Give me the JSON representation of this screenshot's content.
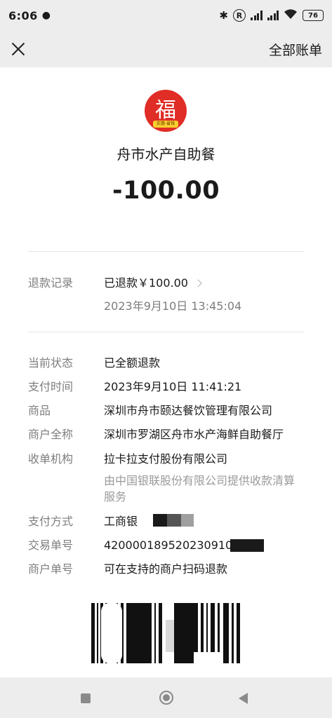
{
  "status_bar": {
    "time": "6:06",
    "left_icon": "notification-icon",
    "right_icons": [
      "bluetooth-icon",
      "registered-icon",
      "signal-icon",
      "signal-icon",
      "wifi-icon",
      "battery-icon"
    ],
    "registered_symbol": "R",
    "battery_level": "76"
  },
  "nav": {
    "close_icon": "close-icon",
    "all_bills_label": "全部账单"
  },
  "merchant": {
    "logo_glyph": "福",
    "logo_tag": "实惠·省钱",
    "name": "舟市水产自助餐",
    "amount": "-100.00"
  },
  "refund": {
    "label": "退款记录",
    "status": "已退款￥100.00",
    "time": "2023年9月10日 13:45:04"
  },
  "details": {
    "status_label": "当前状态",
    "status_value": "已全额退款",
    "pay_time_label": "支付时间",
    "pay_time_value": "2023年9月10日 11:41:21",
    "goods_label": "商品",
    "goods_value": "深圳市舟市颐达餐饮管理有限公司",
    "merchant_full_label": "商户全称",
    "merchant_full_value": "深圳市罗湖区舟市水产海鲜自助餐厅",
    "acquirer_label": "收单机构",
    "acquirer_value": "拉卡拉支付股份有限公司",
    "acquirer_note": "由中国银联股份有限公司提供收款清算服务",
    "pay_method_label": "支付方式",
    "pay_method_value": "工商银",
    "txn_no_label": "交易单号",
    "txn_no_value": "420000189520230910",
    "merchant_no_label": "商户单号",
    "merchant_no_value": "可在支持的商户扫码退款"
  },
  "system_nav": {
    "recent_icon": "recent-apps-icon",
    "home_icon": "home-icon",
    "back_icon": "back-icon"
  },
  "colors": {
    "refund_red": "#d24a3f",
    "logo_red": "#e02d25",
    "background": "#ededed"
  }
}
